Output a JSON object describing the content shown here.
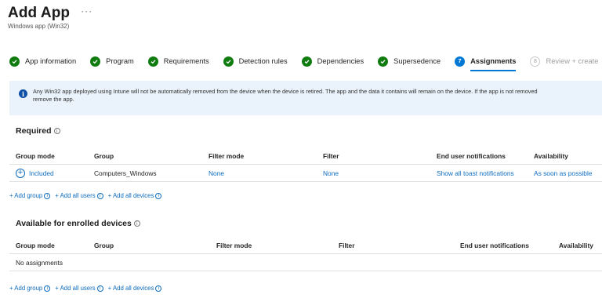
{
  "header": {
    "title": "Add App",
    "more": "···",
    "subtitle": "Windows app (Win32)"
  },
  "steps": [
    {
      "label": "App information",
      "state": "done"
    },
    {
      "label": "Program",
      "state": "done"
    },
    {
      "label": "Requirements",
      "state": "done"
    },
    {
      "label": "Detection rules",
      "state": "done"
    },
    {
      "label": "Dependencies",
      "state": "done"
    },
    {
      "label": "Supersedence",
      "state": "done"
    },
    {
      "label": "Assignments",
      "state": "current",
      "number": "7"
    },
    {
      "label": "Review + create",
      "state": "pending",
      "number": "8"
    }
  ],
  "banner": {
    "icon": "info-icon",
    "line1": "Any Win32 app deployed using Intune will not be automatically removed from the device when the device is retired. The app and the data it contains will remain on the device. If the app is not removed",
    "line2": "remove the app."
  },
  "required": {
    "title": "Required",
    "columns": [
      "Group mode",
      "Group",
      "Filter mode",
      "Filter",
      "End user notifications",
      "Availability"
    ],
    "rows": [
      {
        "group_mode": "Included",
        "group": "Computers_Windows",
        "filter_mode": "None",
        "filter": "None",
        "notifications": "Show all toast notifications",
        "availability": "As soon as possible"
      }
    ],
    "links": {
      "add_group": "+ Add group",
      "add_all_users": "+ Add all users",
      "add_all_devices": "+ Add all devices"
    }
  },
  "available": {
    "title": "Available for enrolled devices",
    "columns": [
      "Group mode",
      "Group",
      "Filter mode",
      "Filter",
      "End user notifications",
      "Availability"
    ],
    "empty": "No assignments",
    "links": {
      "add_group": "+ Add group",
      "add_all_users": "+ Add all users",
      "add_all_devices": "+ Add all devices"
    }
  },
  "colors": {
    "accent": "#0078d4",
    "success": "#107c10",
    "link": "#0f6cbd",
    "banner_bg": "#eaf3fc"
  }
}
